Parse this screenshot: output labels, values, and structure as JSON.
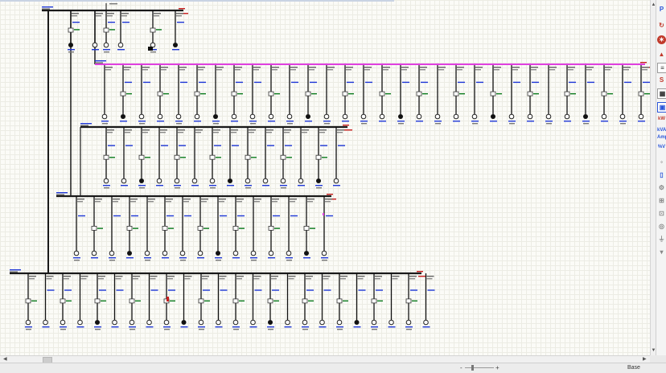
{
  "status_bar": {
    "mode": "Base"
  },
  "toolbar": {
    "icons": [
      "phase-icon",
      "rotate-icon",
      "flash-icon",
      "sequence-icon",
      "report-icon",
      "busbar-icon",
      "table-icon",
      "diagram-icon",
      "kw-icon",
      "kva-amp-icon",
      "percent-v-icon",
      "probe-icon",
      "meter-icon",
      "relay-icon",
      "grid-icon",
      "breaker-icon",
      "motor-icon",
      "ground-icon",
      "load-icon",
      "cable-icon"
    ],
    "labels": {
      "kva": "kVA",
      "amp": "Amp",
      "pct_v": "%V",
      "kw": "kW"
    }
  },
  "colors": {
    "bus": "#1a1a1a",
    "feeder": "#111111",
    "highlight_bus": "#e040e0",
    "label_blue": "#1f37d6",
    "label_green": "#0a7a1c",
    "label_red": "#c81e1e",
    "load_fill": "#111111"
  },
  "diagram": {
    "buses": [
      {
        "id": "bus-main",
        "feeder_count": 7
      },
      {
        "id": "bus-pink",
        "feeder_count": 30,
        "highlighted": true
      },
      {
        "id": "bus-2",
        "feeder_count": 14
      },
      {
        "id": "bus-3",
        "feeder_count": 15
      },
      {
        "id": "bus-4",
        "feeder_count": 24
      }
    ]
  }
}
